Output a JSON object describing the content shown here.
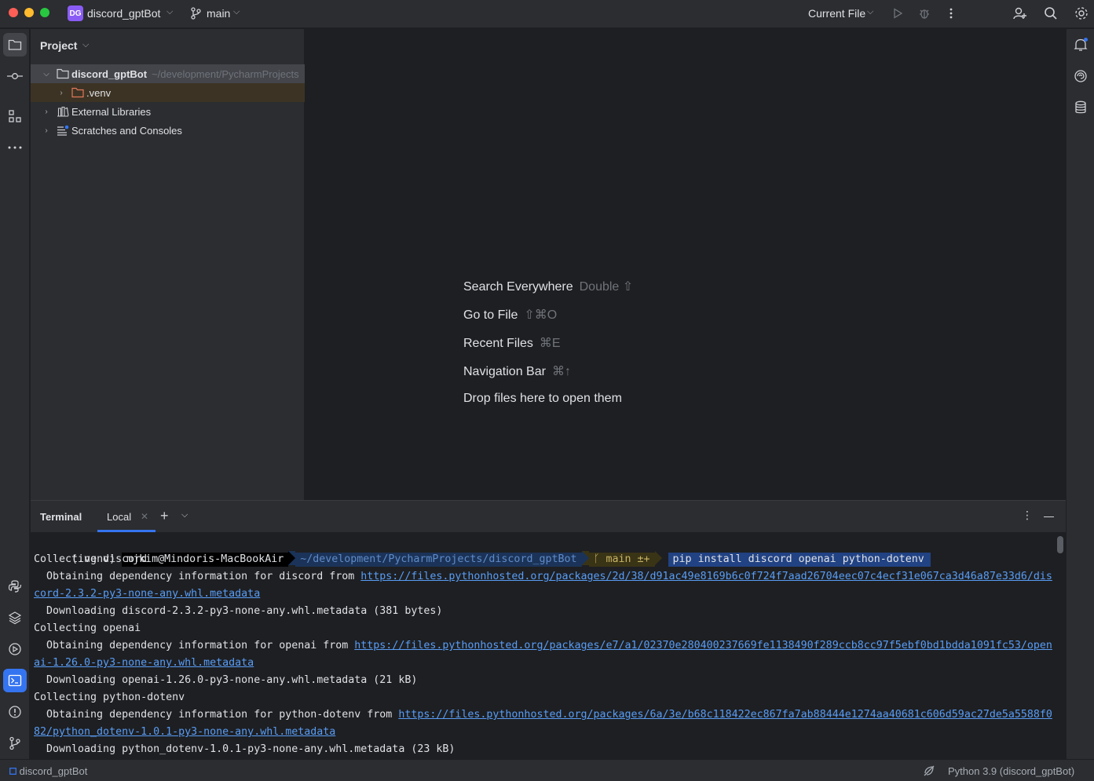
{
  "titlebar": {
    "project_badge": "DG",
    "project_name": "discord_gptBot",
    "branch": "main",
    "run_config": "Current File"
  },
  "project_panel": {
    "title": "Project",
    "tree": [
      {
        "label": "discord_gptBot",
        "path": "~/development/PycharmProjects"
      },
      {
        "label": ".venv"
      },
      {
        "label": "External Libraries"
      },
      {
        "label": "Scratches and Consoles"
      }
    ]
  },
  "editor": {
    "hints": [
      {
        "label": "Search Everywhere",
        "shortcut": "Double ⇧"
      },
      {
        "label": "Go to File",
        "shortcut": "⇧⌘O"
      },
      {
        "label": "Recent Files",
        "shortcut": "⌘E"
      },
      {
        "label": "Navigation Bar",
        "shortcut": "⌘↑"
      },
      {
        "label": "Drop files here to open them",
        "shortcut": ""
      }
    ]
  },
  "terminal": {
    "title": "Terminal",
    "tab": "Local",
    "prompt": {
      "venv": "(.venv)",
      "user": "mjkim@Mindoris-MacBookAir",
      "path": "~/development/PycharmProjects/discord_gptBot",
      "git": "ᚴ main ±+",
      "command": "pip install discord openai python-dotenv"
    },
    "lines": [
      "Collecting discord",
      "  Obtaining dependency information for discord from ",
      "https://files.pythonhosted.org/packages/2d/38/d91ac49e8169b6c0f724f7aad26704eec07c4ecf31e067ca3d46a87e33d6/dis",
      "cord-2.3.2-py3-none-any.whl.metadata",
      "  Downloading discord-2.3.2-py3-none-any.whl.metadata (381 bytes)",
      "Collecting openai",
      "  Obtaining dependency information for openai from ",
      "https://files.pythonhosted.org/packages/e7/a1/02370e280400237669fe1138490f289ccb8cc97f5ebf0bd1bdda1091fc53/open",
      "ai-1.26.0-py3-none-any.whl.metadata",
      "  Downloading openai-1.26.0-py3-none-any.whl.metadata (21 kB)",
      "Collecting python-dotenv",
      "  Obtaining dependency information for python-dotenv from ",
      "https://files.pythonhosted.org/packages/6a/3e/b68c118422ec867fa7ab88444e1274aa40681c606d59ac27de5a5588f0",
      "82/python_dotenv-1.0.1-py3-none-any.whl.metadata",
      "  Downloading python_dotenv-1.0.1-py3-none-any.whl.metadata (23 kB)"
    ]
  },
  "statusbar": {
    "project": "discord_gptBot",
    "interpreter": "Python 3.9 (discord_gptBot)"
  },
  "colors": {
    "accent": "#3574f0",
    "background": "#1e1f22",
    "panel": "#2b2d30",
    "link": "#589df6"
  }
}
